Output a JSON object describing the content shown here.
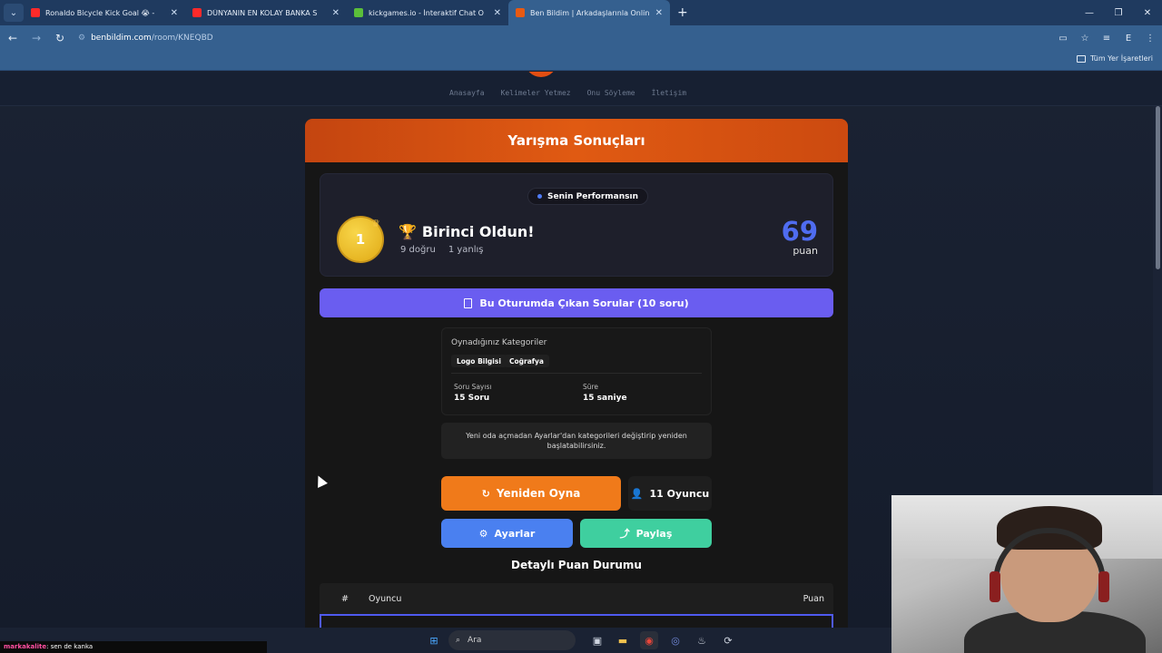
{
  "browser": {
    "tabs": [
      {
        "title": "Ronaldo Bicycle Kick Goal 😭 -",
        "favicon_color": "#ff2a2a",
        "active": false
      },
      {
        "title": "DÜNYANIN EN KOLAY BANKA S",
        "favicon_color": "#ff2a2a",
        "active": false
      },
      {
        "title": "kickgames.io - İnteraktif Chat O",
        "favicon_color": "#5bbf3a",
        "active": false
      },
      {
        "title": "Ben Bildim | Arkadaşlarınla Onlin",
        "favicon_color": "#e85a12",
        "active": true
      }
    ],
    "url_host": "benbildim.com",
    "url_path": "/room/KNEQBD",
    "bookmarks_all": "Tüm Yer İşaretleri"
  },
  "site": {
    "nav": [
      "Anasayfa",
      "Kelimeler Yetmez",
      "Onu Söyleme",
      "İletişim"
    ]
  },
  "results": {
    "title": "Yarışma Sonuçları",
    "performance_badge": "Senin Performansın",
    "rank": "1",
    "rank_title": "Birinci Oldun!",
    "correct": "9 doğru",
    "wrong": "1 yanlış",
    "score": "69",
    "score_label": "puan",
    "questions_button": "Bu Oturumda Çıkan Sorular (10 soru)",
    "categories_title": "Oynadığınız Kategoriler",
    "categories": [
      "Logo Bilgisi",
      "Coğrafya"
    ],
    "question_count_label": "Soru Sayısı",
    "question_count_value": "15 Soru",
    "duration_label": "Süre",
    "duration_value": "15 saniye",
    "notice": "Yeni oda açmadan Ayarlar'dan kategorileri değiştirip yeniden başlatabilirsiniz.",
    "replay_button": "Yeniden Oyna",
    "players_button": "11 Oyuncu",
    "settings_button": "Ayarlar",
    "share_button": "Paylaş",
    "detail_title": "Detaylı Puan Durumu",
    "table_headers": {
      "rank": "#",
      "player": "Oyuncu",
      "points": "Puan"
    }
  },
  "chat": {
    "user": "markakalite",
    "message": ": sen de kanka"
  },
  "taskbar": {
    "search_placeholder": "Ara"
  },
  "colors": {
    "accent_orange": "#e05a12",
    "accent_purple": "#6a5df0",
    "score_blue": "#4f6cf0",
    "settings_blue": "#4a80f0",
    "share_green": "#3fcf9f"
  }
}
